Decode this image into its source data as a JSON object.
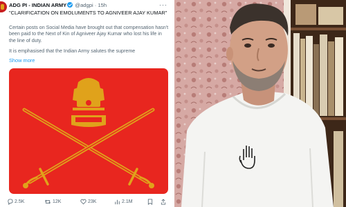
{
  "tweet": {
    "author_name": "ADG PI - INDIAN ARMY",
    "handle": "@adgpi",
    "separator": "·",
    "time": "15h",
    "headline": "\"CLARIFICATION ON EMOLUMENTS TO AGNIVEER AJAY KUMAR\"",
    "paragraphs": [
      "Certain posts on Social Media have brought out that compensation hasn't been paid to the Next of Kin of Agniveer Ajay Kumar who lost his life in the line of duty.",
      "It is emphasised that the Indian Army salutes the supreme"
    ],
    "show_more": "Show more",
    "actions": {
      "replies": "2.5K",
      "reposts": "12K",
      "likes": "23K",
      "views": "2.1M"
    },
    "icons": {
      "more": "more-options-icon",
      "reply": "reply-icon",
      "repost": "repost-icon",
      "like": "heart-icon",
      "views": "views-chart-icon",
      "bookmark": "bookmark-icon",
      "share": "share-icon",
      "verified": "verified-badge-icon"
    }
  },
  "colors": {
    "link_blue": "#1d9bf0",
    "flag_red": "#e8261f",
    "emblem_gold": "#e0a21b",
    "muted_text": "#536471"
  }
}
